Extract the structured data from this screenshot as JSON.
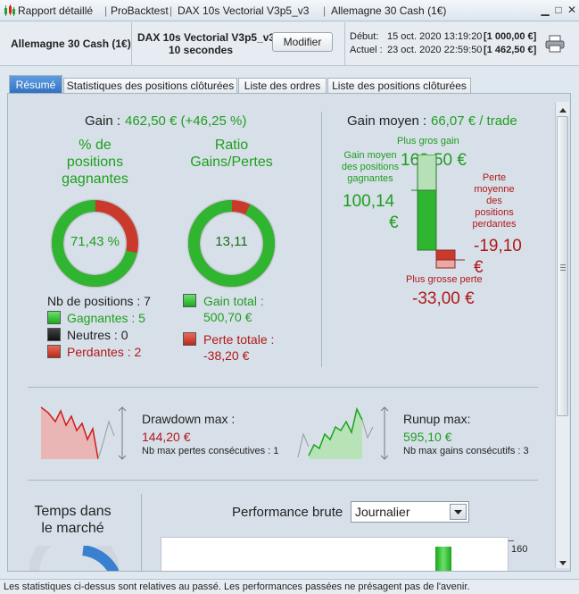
{
  "titlebar": {
    "seg1": "Rapport détaillé",
    "seg2": "ProBacktest",
    "seg3": "DAX 10s Vectorial V3p5_v3",
    "seg4": "Allemagne 30 Cash (1€)"
  },
  "header": {
    "instrument": "Allemagne 30 Cash (1€)",
    "strategy_name": "DAX 10s Vectorial V3p5_v3",
    "timeframe": "10 secondes",
    "modify_label": "Modifier",
    "start_label": "Début:",
    "start_date": "15 oct. 2020 13:19:20",
    "start_value": "[1 000,00 €]",
    "current_label": "Actuel :",
    "current_date": "23 oct. 2020 22:59:50",
    "current_value": "[1 462,50 €]"
  },
  "tabs": [
    {
      "label": "Résumé"
    },
    {
      "label": "Statistiques des positions clôturées"
    },
    {
      "label": "Liste des ordres"
    },
    {
      "label": "Liste des positions clôturées"
    }
  ],
  "summary": {
    "gain_label": "Gain :",
    "gain_value": "462,50 € (+46,25 %)",
    "winning_pct_title_1": "% de",
    "winning_pct_title_2": "positions",
    "winning_pct_title_3": "gagnantes",
    "winning_pct_value": "71,43 %",
    "winning_pct": 71.43,
    "ratio_title_1": "Ratio",
    "ratio_title_2": "Gains/Pertes",
    "ratio_value": "13,11",
    "ratio_win_fraction": 0.929,
    "nb_positions": "Nb de positions : 7",
    "winners": "Gagnantes : 5",
    "neutral": "Neutres : 0",
    "losers": "Perdantes : 2",
    "total_gain_label": "Gain total :",
    "total_gain_value": "500,70 €",
    "total_loss_label": "Perte totale :",
    "total_loss_value": "-38,20 €",
    "avg_gain_label": "Gain moyen :",
    "avg_gain_value": "66,07 € / trade",
    "biggest_gain_label": "Plus gros gain",
    "biggest_gain_value": "163,50 €",
    "avg_win_label_1": "Gain moyen",
    "avg_win_label_2": "des positions",
    "avg_win_label_3": "gagnantes",
    "avg_win_value_1": "100,14",
    "avg_win_value_2": "€",
    "avg_loss_label_1": "Perte",
    "avg_loss_label_2": "moyenne",
    "avg_loss_label_3": "des",
    "avg_loss_label_4": "positions",
    "avg_loss_label_5": "perdantes",
    "avg_loss_value_1": "-19,10",
    "avg_loss_value_2": "€",
    "biggest_loss_label": "Plus grosse perte",
    "biggest_loss_value": "-33,00 €"
  },
  "drawdown": {
    "label": "Drawdown max :",
    "value": "144,20 €",
    "sub": "Nb max pertes consécutives : 1"
  },
  "runup": {
    "label": "Runup max:",
    "value": "595,10 €",
    "sub": "Nb max gains consécutifs : 3"
  },
  "market_time": {
    "title_1": "Temps dans",
    "title_2": "le marché"
  },
  "performance": {
    "label": "Performance brute",
    "period": "Journalier",
    "axis_tick": "160"
  },
  "statusbar": {
    "text": "Les statistiques ci-dessus sont relatives au passé. Les performances passées ne présagent pas de l'avenir."
  },
  "colors": {
    "green": "#1e9e1e",
    "red": "#b01818",
    "accent_tab": "#2f6fc1"
  }
}
